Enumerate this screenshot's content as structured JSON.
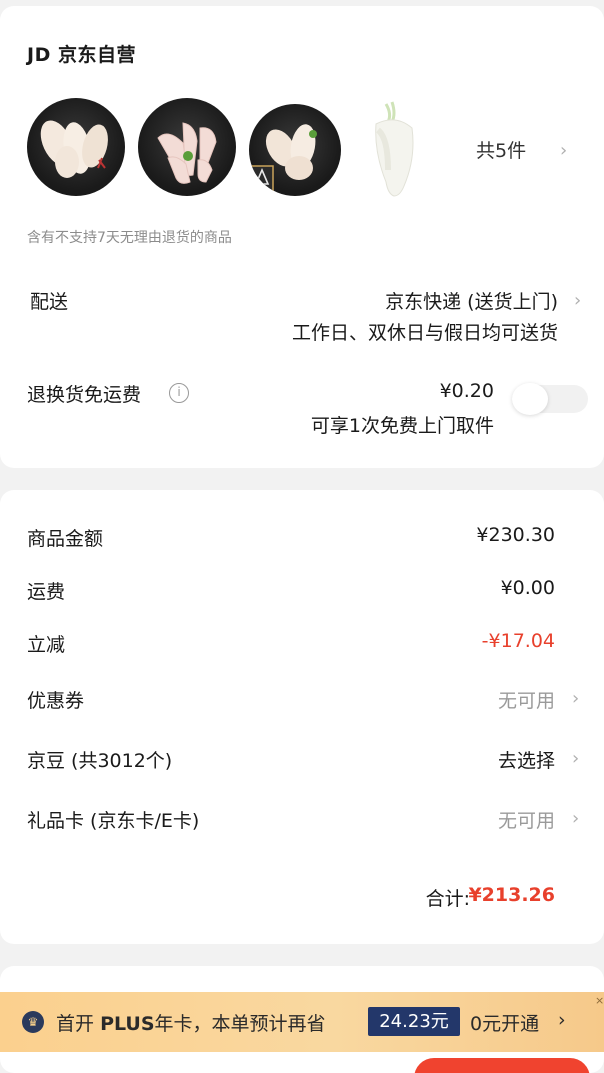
{
  "shop": {
    "name": "JD 京东自营",
    "item_count_label": "共5件",
    "items": [
      {
        "icon": "chicken-wings-image"
      },
      {
        "icon": "chicken-feet-image"
      },
      {
        "icon": "chicken-wings-image"
      },
      {
        "icon": "white-radish-image"
      }
    ],
    "return_notice": "含有不支持7天无理由退货的商品"
  },
  "delivery": {
    "label": "配送",
    "method": "京东快递 (送货上门)",
    "schedule": "工作日、双休日与假日均可送货"
  },
  "return_shipping": {
    "label": "退换货免运费",
    "price": "¥0.20",
    "desc": "可享1次免费上门取件",
    "enabled": false
  },
  "summary": {
    "goods_amount_label": "商品金额",
    "goods_amount": "¥230.30",
    "shipping_label": "运费",
    "shipping": "¥0.00",
    "discount_label": "立减",
    "discount": "-¥17.04",
    "coupon_label": "优惠券",
    "coupon_value": "无可用",
    "beans_label": "京豆 (共3012个)",
    "beans_value": "去选择",
    "giftcard_label": "礼品卡 (京东卡/E卡)",
    "giftcard_value": "无可用",
    "total_label": "合计:",
    "total": "¥213.26"
  },
  "plus": {
    "prefix": "首开",
    "brand": "PLUS",
    "text": "年卡，本单预计再省",
    "save_amount": "24.23元",
    "cta": "0元开通",
    "cta_arrow": "›",
    "close": "×"
  },
  "colors": {
    "accent_red": "#e8402c",
    "plus_navy": "#23376a",
    "plus_gold": "#f9d8a0"
  }
}
